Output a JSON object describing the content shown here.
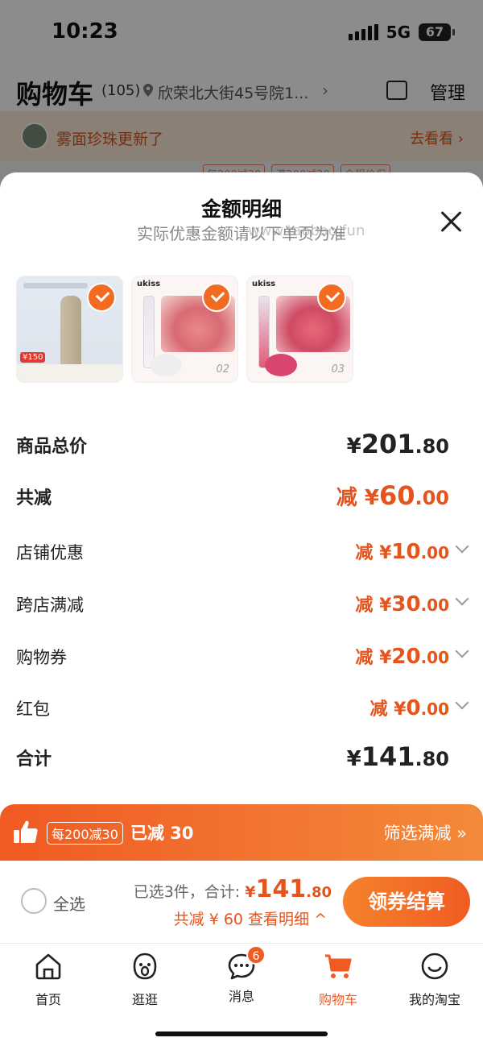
{
  "status_bar": {
    "time": "10:23",
    "network": "5G",
    "battery": "67"
  },
  "header": {
    "title": "购物车",
    "count": "(105)",
    "address": "欣荣北大街45号院1...",
    "manage_label": "管理"
  },
  "notice": {
    "text": "雾面珍珠更新了",
    "link": "去看看 ›"
  },
  "background_tags": [
    "每200减30",
    "满200减30",
    "全程价保"
  ],
  "sheet": {
    "title": "金额明细",
    "subtitle": "实际优惠金额请以下单页为准",
    "watermark": "www.taobao.fun",
    "products": [
      {
        "brand": "",
        "tag": "¥150",
        "shade": ""
      },
      {
        "brand": "ukiss",
        "tag": "",
        "shade": "02"
      },
      {
        "brand": "ukiss",
        "tag": "",
        "shade": "03"
      }
    ],
    "rows": {
      "total_price": {
        "label": "商品总价",
        "prefix": "¥",
        "int": "201",
        "dec": ".80"
      },
      "total_discount": {
        "label": "共减",
        "prefix": "减 ¥",
        "int": "60",
        "dec": ".00"
      },
      "shop_discount": {
        "label": "店铺优惠",
        "prefix": "减 ¥",
        "int": "10",
        "dec": ".00"
      },
      "cross_store": {
        "label": "跨店满减",
        "prefix": "减 ¥",
        "int": "30",
        "dec": ".00"
      },
      "coupon": {
        "label": "购物券",
        "prefix": "减 ¥",
        "int": "20",
        "dec": ".00"
      },
      "red_packet": {
        "label": "红包",
        "prefix": "减 ¥",
        "int": "0",
        "dec": ".00"
      },
      "sum": {
        "label": "合计",
        "prefix": "¥",
        "int": "141",
        "dec": ".80"
      }
    }
  },
  "promo": {
    "badge": "每200减30",
    "saved": "已减 30",
    "filter": "筛选满减 »"
  },
  "checkout": {
    "select_all": "全选",
    "selected": "已选3件，合计:",
    "currency": "¥",
    "total_int": "141",
    "total_dec": ".80",
    "discount_line": "共减 ¥ 60  查看明细 ^",
    "button": "领券结算"
  },
  "tabbar": [
    {
      "label": "首页",
      "icon": "home-icon"
    },
    {
      "label": "逛逛",
      "icon": "browse-icon"
    },
    {
      "label": "消息",
      "icon": "message-icon",
      "badge": "6"
    },
    {
      "label": "购物车",
      "icon": "cart-icon"
    },
    {
      "label": "我的淘宝",
      "icon": "profile-icon"
    }
  ],
  "colors": {
    "accent": "#f05a23",
    "discount": "#e4541c"
  }
}
